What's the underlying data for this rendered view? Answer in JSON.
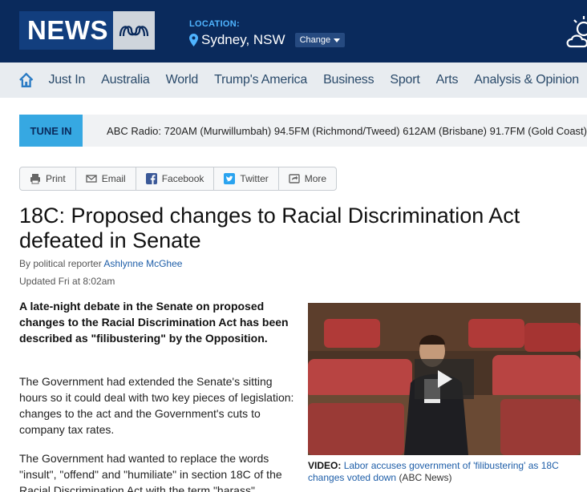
{
  "header": {
    "logo_text": "NEWS",
    "logo_brand": "ABC",
    "location_label": "LOCATION:",
    "location_city": "Sydney, NSW",
    "change_label": "Change",
    "weather_icon": "partly-cloudy-icon"
  },
  "nav": {
    "items": [
      "Just In",
      "Australia",
      "World",
      "Trump's America",
      "Business",
      "Sport",
      "Arts",
      "Analysis & Opinion"
    ]
  },
  "tune_in": {
    "label": "TUNE IN",
    "text": "ABC Radio: 720AM (Murwillumbah) 94.5FM (Richmond/Tweed) 612AM (Brisbane) 91.7FM (Gold Coast)"
  },
  "share": {
    "print": "Print",
    "email": "Email",
    "facebook": "Facebook",
    "twitter": "Twitter",
    "more": "More"
  },
  "article": {
    "headline": "18C: Proposed changes to Racial Discrimination Act defeated in Senate",
    "byline_prefix": "By political reporter",
    "author": "Ashlynne McGhee",
    "updated": "Updated Fri at 8:02am",
    "lead": "A late-night debate in the Senate on proposed changes to the Racial Discrimination Act has been described as \"filibustering\" by the Opposition.",
    "paragraphs": [
      "The Government had extended the Senate's sitting hours so it could deal with two key pieces of legislation: changes to the act and the Government's cuts to company tax rates.",
      "The Government had wanted to replace the words \"insult\", \"offend\" and \"humiliate\" in section 18C of the Racial Discrimination Act with the term \"harass\"."
    ]
  },
  "video": {
    "label": "VIDEO:",
    "title": "Labor accuses government of 'filibustering' as 18C changes voted down",
    "source": "(ABC News)"
  },
  "colors": {
    "header_bg": "#0a2a5c",
    "accent": "#36a8e2",
    "link": "#1e5ea8"
  }
}
